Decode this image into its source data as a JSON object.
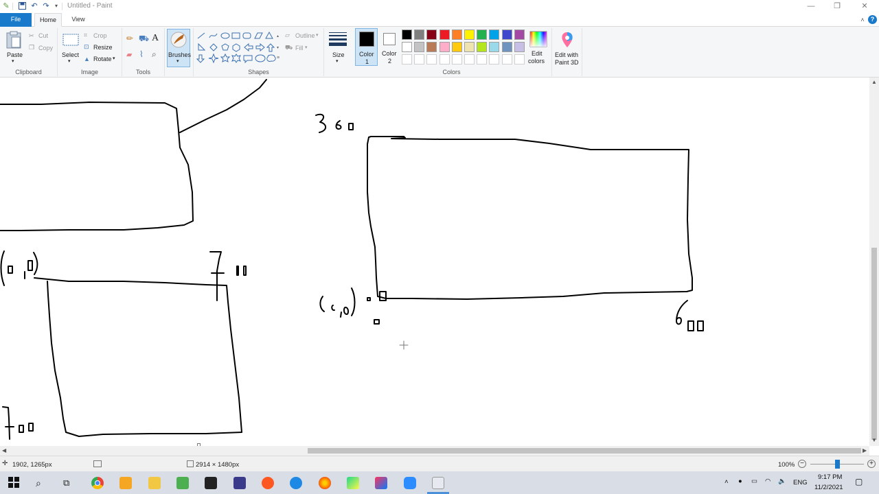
{
  "window": {
    "title": "Untitled - Paint",
    "minimize_icon": "minimize-icon",
    "maximize_icon": "restore-icon",
    "close_icon": "close-icon"
  },
  "quick_access": [
    "paint-app-icon",
    "save-icon",
    "undo-icon",
    "redo-icon",
    "customize-icon"
  ],
  "tabs": [
    {
      "label": "File"
    },
    {
      "label": "Home"
    },
    {
      "label": "View"
    }
  ],
  "ribbon": {
    "clipboard": {
      "paste": "Paste",
      "cut": "Cut",
      "copy": "Copy",
      "group_label": "Clipboard"
    },
    "image": {
      "select": "Select",
      "crop": "Crop",
      "resize": "Resize",
      "rotate": "Rotate",
      "group_label": "Image"
    },
    "tools": {
      "group_label": "Tools",
      "items": [
        "pencil-icon",
        "fill-icon",
        "text-icon",
        "eraser-icon",
        "color-picker-icon",
        "magnifier-icon"
      ]
    },
    "brushes": {
      "label": "Brushes"
    },
    "shapes": {
      "outline": "Outline",
      "fill": "Fill",
      "group_label": "Shapes"
    },
    "size": {
      "label": "Size"
    },
    "color1": {
      "label": "Color",
      "num": "1",
      "value": "#000000"
    },
    "color2": {
      "label": "Color",
      "num": "2",
      "value": "#ffffff"
    },
    "colors": {
      "group_label": "Colors",
      "row1": [
        "#000000",
        "#7f7f7f",
        "#880015",
        "#ed1c24",
        "#ff7f27",
        "#fff200",
        "#22b14c",
        "#00a2e8",
        "#3f48cc",
        "#a349a4"
      ],
      "row2": [
        "#ffffff",
        "#c3c3c3",
        "#b97a57",
        "#ffaec9",
        "#ffc90e",
        "#efe4b0",
        "#b5e61d",
        "#99d9ea",
        "#7092be",
        "#c8bfe7"
      ]
    },
    "edit_colors": {
      "line1": "Edit",
      "line2": "colors"
    },
    "paint3d": {
      "line1": "Edit with",
      "line2": "Paint 3D"
    }
  },
  "canvas": {
    "labels": [
      "360",
      "(0,0)",
      "0",
      "0",
      "600",
      "(0,0)",
      "700",
      "700"
    ]
  },
  "status": {
    "cursor_pos": "1902, 1265px",
    "image_size": "2914 × 1480px",
    "zoom": "100%",
    "zoom_level": 0.5
  },
  "taskbar": {
    "apps": [
      "start-icon",
      "search-icon",
      "task-view-icon",
      "chrome-icon",
      "media-player-icon",
      "file-explorer-icon",
      "notepad-icon",
      "terminal-icon",
      "game-icon",
      "compass-icon",
      "cloud-icon",
      "firefox-icon",
      "pycharm-icon",
      "intellij-icon",
      "zoom-icon",
      "paint-icon"
    ],
    "lang": "ENG",
    "time": "9:17 PM",
    "date": "11/2/2021"
  }
}
